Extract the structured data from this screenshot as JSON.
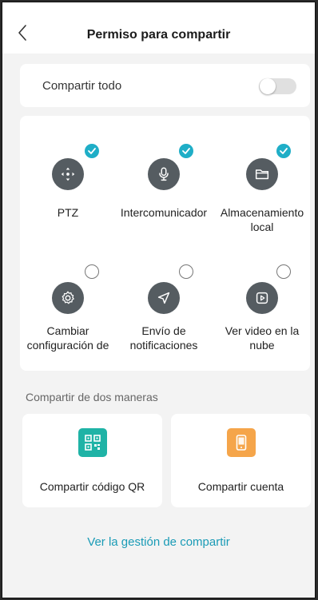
{
  "header": {
    "title": "Permiso para compartir"
  },
  "share_all": {
    "label": "Compartir todo",
    "enabled": false
  },
  "permissions": [
    {
      "label": "PTZ",
      "icon": "ptz-icon",
      "checked": true
    },
    {
      "label": "Intercomunicador",
      "icon": "microphone-icon",
      "checked": true
    },
    {
      "label": "Almacenamiento local",
      "icon": "folder-icon",
      "checked": true
    },
    {
      "label": "Cambiar configuración de",
      "icon": "gear-icon",
      "checked": false
    },
    {
      "label": "Envío de notificaciones",
      "icon": "send-icon",
      "checked": false
    },
    {
      "label": "Ver video en la nube",
      "icon": "play-icon",
      "checked": false
    }
  ],
  "share_methods": {
    "title": "Compartir de dos maneras",
    "qr": {
      "label": "Compartir código QR",
      "icon": "qr-code-icon",
      "color": "#1fb3a6"
    },
    "account": {
      "label": "Compartir cuenta",
      "icon": "phone-icon",
      "color": "#f5a54a"
    }
  },
  "manage_link": "Ver la gestión de compartir",
  "colors": {
    "accent": "#1faec7",
    "icon_bg": "#555c61"
  }
}
